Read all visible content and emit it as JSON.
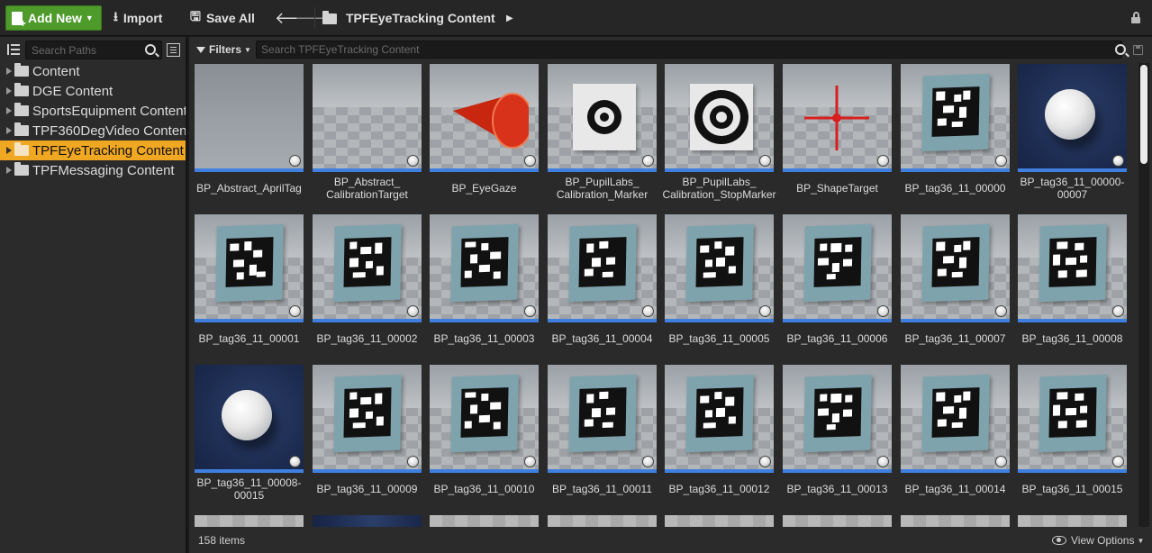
{
  "toolbar": {
    "add_new_label": "Add New",
    "import_label": "Import",
    "save_all_label": "Save All",
    "breadcrumb": "TPFEyeTracking Content"
  },
  "sources": {
    "search_placeholder": "Search Paths",
    "items": [
      {
        "label": "Content",
        "selected": false
      },
      {
        "label": "DGE Content",
        "selected": false
      },
      {
        "label": "SportsEquipment Content",
        "selected": false
      },
      {
        "label": "TPF360DegVideo Content",
        "selected": false
      },
      {
        "label": "TPFEyeTracking Content",
        "selected": true
      },
      {
        "label": "TPFMessaging Content",
        "selected": false
      }
    ]
  },
  "assets": {
    "filters_label": "Filters",
    "search_placeholder": "Search TPFEyeTracking Content",
    "items": [
      {
        "name": "BP_Abstract_AprilTag",
        "thumb": "flat"
      },
      {
        "name": "BP_Abstract_\nCalibrationTarget",
        "thumb": "floor"
      },
      {
        "name": "BP_EyeGaze",
        "thumb": "cone"
      },
      {
        "name": "BP_PupilLabs_\nCalibration_Marker",
        "thumb": "marker"
      },
      {
        "name": "BP_PupilLabs_\nCalibration_StopMarker",
        "thumb": "stopmarker"
      },
      {
        "name": "BP_ShapeTarget",
        "thumb": "crosshair"
      },
      {
        "name": "BP_tag36_11_00000",
        "thumb": "tag"
      },
      {
        "name": "BP_tag36_11_00000-\n00007",
        "thumb": "sphere"
      },
      {
        "name": "BP_tag36_11_00001",
        "thumb": "tag"
      },
      {
        "name": "BP_tag36_11_00002",
        "thumb": "tag"
      },
      {
        "name": "BP_tag36_11_00003",
        "thumb": "tag"
      },
      {
        "name": "BP_tag36_11_00004",
        "thumb": "tag"
      },
      {
        "name": "BP_tag36_11_00005",
        "thumb": "tag"
      },
      {
        "name": "BP_tag36_11_00006",
        "thumb": "tag"
      },
      {
        "name": "BP_tag36_11_00007",
        "thumb": "tag"
      },
      {
        "name": "BP_tag36_11_00008",
        "thumb": "tag"
      },
      {
        "name": "BP_tag36_11_00008-\n00015",
        "thumb": "sphere"
      },
      {
        "name": "BP_tag36_11_00009",
        "thumb": "tag"
      },
      {
        "name": "BP_tag36_11_00010",
        "thumb": "tag"
      },
      {
        "name": "BP_tag36_11_00011",
        "thumb": "tag"
      },
      {
        "name": "BP_tag36_11_00012",
        "thumb": "tag"
      },
      {
        "name": "BP_tag36_11_00013",
        "thumb": "tag"
      },
      {
        "name": "BP_tag36_11_00014",
        "thumb": "tag"
      },
      {
        "name": "BP_tag36_11_00015",
        "thumb": "tag"
      }
    ]
  },
  "status": {
    "item_count": "158 items",
    "view_options_label": "View Options"
  },
  "colors": {
    "accent_green": "#4e9a2b",
    "selection_orange": "#f0a722",
    "asset_type_bar": "#3f7fe0"
  }
}
